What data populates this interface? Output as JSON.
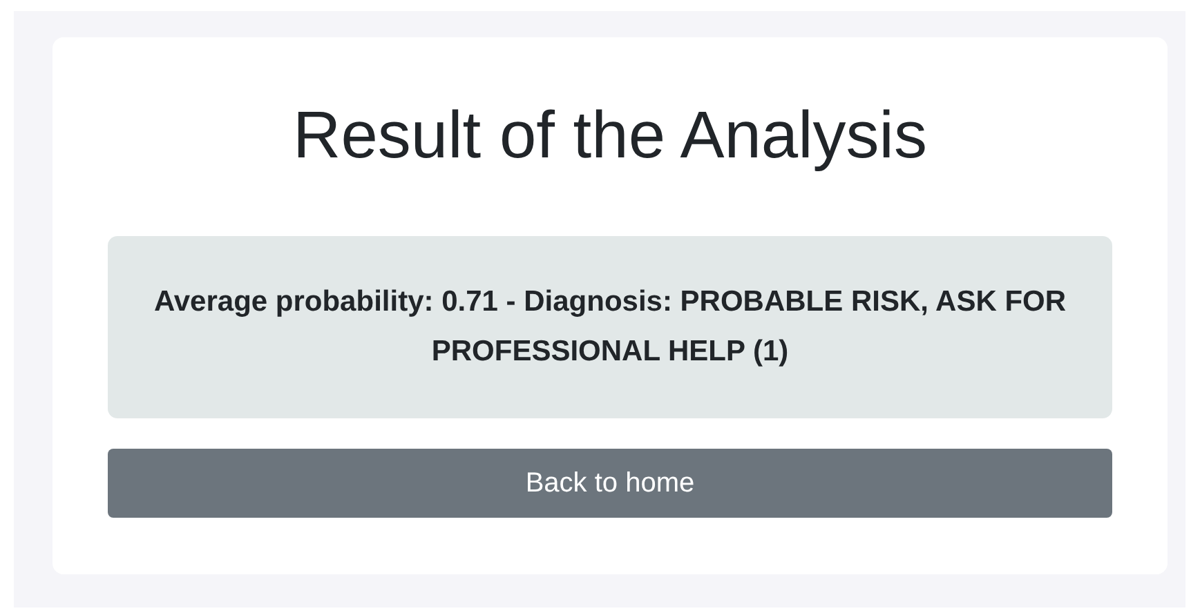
{
  "title": "Result of the Analysis",
  "result": {
    "text": "Average probability: 0.71 - Diagnosis: PROBABLE RISK, ASK FOR PROFESSIONAL HELP (1)"
  },
  "buttons": [
    {
      "label": "Back to home",
      "kind": "secondary"
    }
  ]
}
